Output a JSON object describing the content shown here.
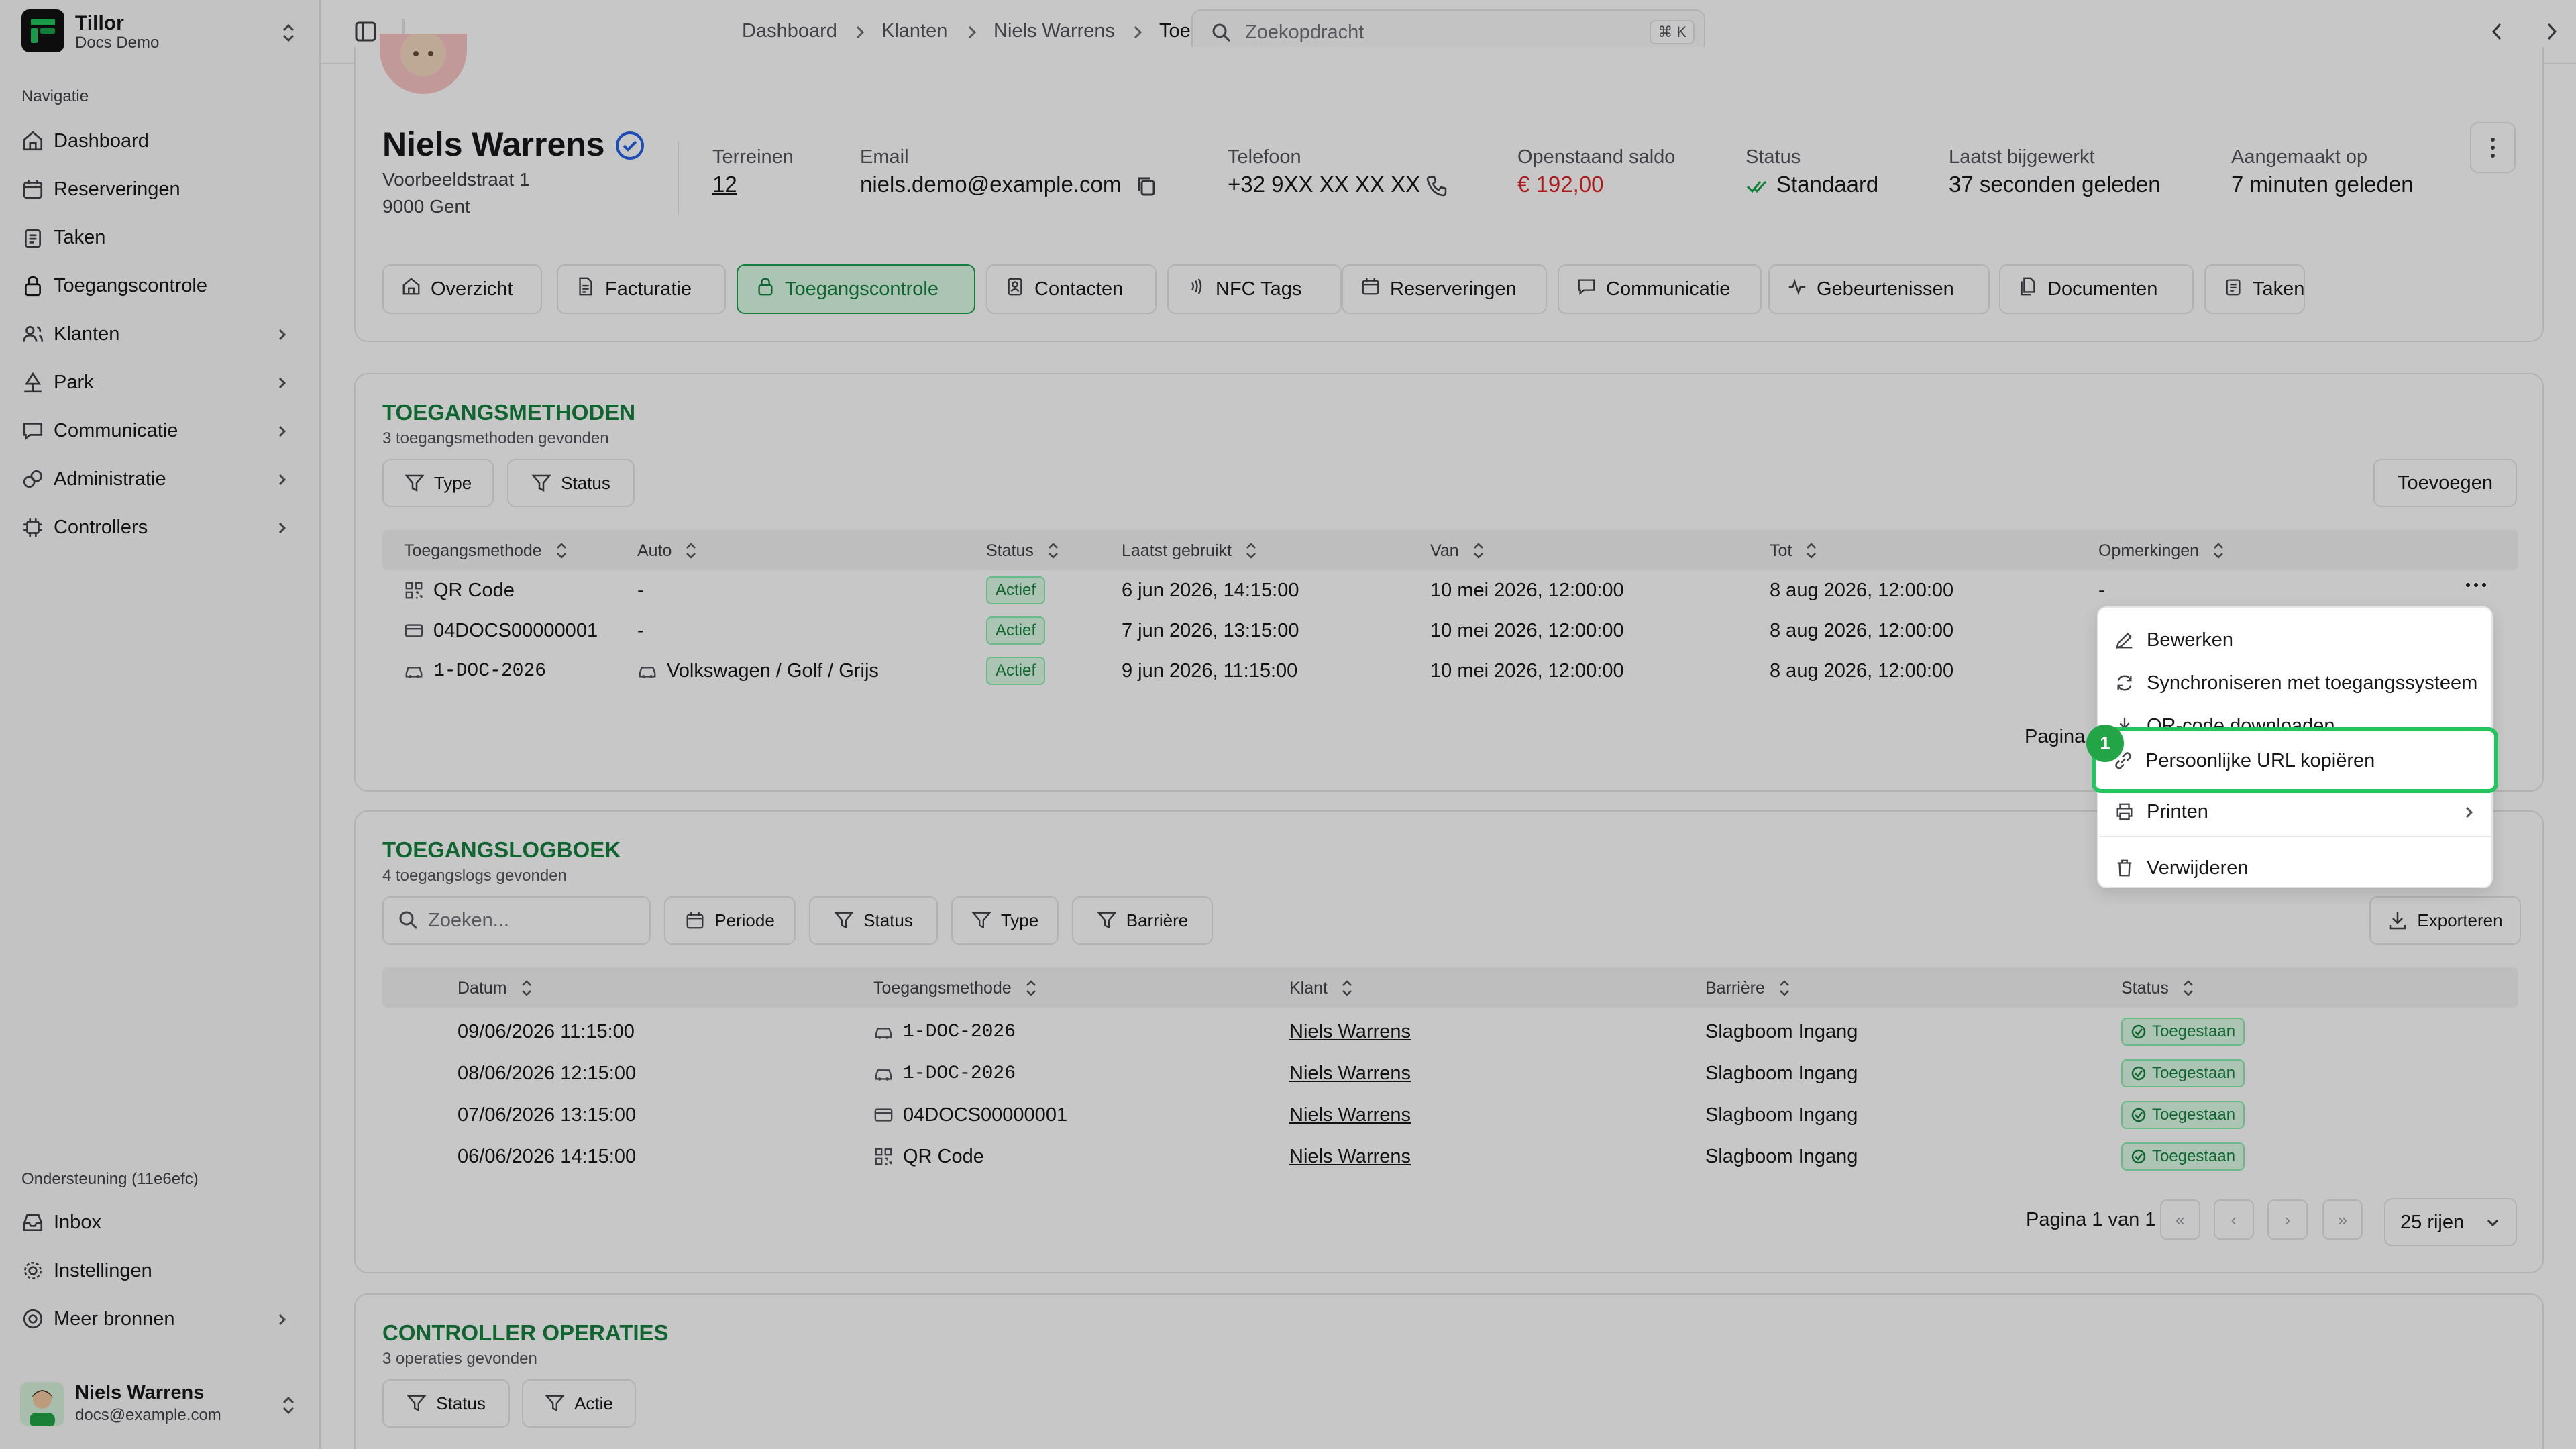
{
  "brand": {
    "name": "Tillor",
    "sub": "Docs Demo"
  },
  "nav": {
    "section_label": "Navigatie",
    "items": [
      {
        "label": "Dashboard",
        "icon": "home-icon"
      },
      {
        "label": "Reserveringen",
        "icon": "calendar-icon"
      },
      {
        "label": "Taken",
        "icon": "clipboard-icon"
      },
      {
        "label": "Toegangscontrole",
        "icon": "lock-icon"
      },
      {
        "label": "Klanten",
        "icon": "users-icon"
      },
      {
        "label": "Park",
        "icon": "tree-icon"
      },
      {
        "label": "Communicatie",
        "icon": "chat-icon"
      },
      {
        "label": "Administratie",
        "icon": "coins-icon"
      },
      {
        "label": "Controllers",
        "icon": "chip-icon"
      }
    ],
    "support_label": "Ondersteuning (11e6efc)",
    "support_items": [
      {
        "label": "Inbox",
        "icon": "inbox-icon"
      },
      {
        "label": "Instellingen",
        "icon": "gear-icon"
      },
      {
        "label": "Meer bronnen",
        "icon": "lifebuoy-icon"
      }
    ]
  },
  "user": {
    "name": "Niels Warrens",
    "email": "docs@example.com"
  },
  "breadcrumb": [
    "Dashboard",
    "Klanten",
    "Niels Warrens",
    "Toegangscontrole"
  ],
  "search": {
    "placeholder": "Zoekopdracht",
    "shortcut": "⌘ K"
  },
  "customer": {
    "name": "Niels Warrens",
    "address1": "Voorbeeldstraat 1",
    "address2": "9000 Gent",
    "fields": {
      "terreinen_label": "Terreinen",
      "terreinen": "12",
      "email_label": "Email",
      "email": "niels.demo@example.com",
      "telefoon_label": "Telefoon",
      "telefoon": "+32 9XX XX XX XX",
      "saldo_label": "Openstaand saldo",
      "saldo": "€ 192,00",
      "status_label": "Status",
      "status": "Standaard",
      "bijgewerkt_label": "Laatst bijgewerkt",
      "bijgewerkt": "37 seconden geleden",
      "aangemaakt_label": "Aangemaakt op",
      "aangemaakt": "7 minuten geleden"
    }
  },
  "tabs": [
    {
      "label": "Overzicht",
      "icon": "home-icon"
    },
    {
      "label": "Facturatie",
      "icon": "file-icon"
    },
    {
      "label": "Toegangscontrole",
      "icon": "lock-icon"
    },
    {
      "label": "Contacten",
      "icon": "contact-icon"
    },
    {
      "label": "NFC Tags",
      "icon": "nfc-icon"
    },
    {
      "label": "Reserveringen",
      "icon": "calendar-icon"
    },
    {
      "label": "Communicatie",
      "icon": "chat-icon"
    },
    {
      "label": "Gebeurtenissen",
      "icon": "activity-icon"
    },
    {
      "label": "Documenten",
      "icon": "documents-icon"
    },
    {
      "label": "Taken",
      "icon": "clipboard-icon"
    }
  ],
  "methods": {
    "title": "TOEGANGSMETHODEN",
    "subtitle": "3 toegangsmethoden gevonden",
    "filter_type": "Type",
    "filter_status": "Status",
    "add_button": "Toevoegen",
    "columns": [
      "Toegangsmethode",
      "Auto",
      "Status",
      "Laatst gebruikt",
      "Van",
      "Tot",
      "Opmerkingen"
    ],
    "rows": [
      {
        "method": "QR Code",
        "icon": "qr-icon",
        "auto": "-",
        "auto_icon": "",
        "status": "Actief",
        "last": "6 jun 2026, 14:15:00",
        "from": "10 mei 2026, 12:00:00",
        "to": "8 aug 2026, 12:00:00",
        "notes": "-"
      },
      {
        "method": "04DOCS00000001",
        "icon": "card-icon",
        "auto": "-",
        "auto_icon": "",
        "status": "Actief",
        "last": "7 jun 2026, 13:15:00",
        "from": "10 mei 2026, 12:00:00",
        "to": "8 aug 2026, 12:00:00",
        "notes": ""
      },
      {
        "method": "1-DOC-2026",
        "icon": "car-icon",
        "auto": "Volkswagen / Golf / Grijs",
        "auto_icon": "car-icon",
        "status": "Actief",
        "last": "9 jun 2026, 11:15:00",
        "from": "10 mei 2026, 12:00:00",
        "to": "8 aug 2026, 12:00:00",
        "notes": ""
      }
    ],
    "pagination": "Pagina"
  },
  "menu": {
    "items": [
      {
        "label": "Bewerken",
        "icon": "edit-icon"
      },
      {
        "label": "Synchroniseren met toegangssysteem",
        "icon": "sync-icon"
      },
      {
        "label": "QR-code downloaden",
        "icon": "download-icon"
      },
      {
        "label": "Persoonlijke URL kopiëren",
        "icon": "link-icon"
      },
      {
        "label": "Printen",
        "icon": "printer-icon"
      },
      {
        "label": "Verwijderen",
        "icon": "trash-icon"
      }
    ],
    "highlight_number": "1"
  },
  "logbook": {
    "title": "TOEGANGSLOGBOEK",
    "subtitle": "4 toegangslogs gevonden",
    "search_placeholder": "Zoeken...",
    "filters": [
      "Periode",
      "Status",
      "Type",
      "Barrière"
    ],
    "export_button": "Exporteren",
    "columns": [
      "Datum",
      "Toegangsmethode",
      "Klant",
      "Barrière",
      "Status"
    ],
    "rows": [
      {
        "date": "09/06/2026 11:15:00",
        "method": "1-DOC-2026",
        "icon": "car-icon",
        "customer": "Niels Warrens",
        "barrier": "Slagboom Ingang",
        "status": "Toegestaan"
      },
      {
        "date": "08/06/2026 12:15:00",
        "method": "1-DOC-2026",
        "icon": "car-icon",
        "customer": "Niels Warrens",
        "barrier": "Slagboom Ingang",
        "status": "Toegestaan"
      },
      {
        "date": "07/06/2026 13:15:00",
        "method": "04DOCS00000001",
        "icon": "card-icon",
        "customer": "Niels Warrens",
        "barrier": "Slagboom Ingang",
        "status": "Toegestaan"
      },
      {
        "date": "06/06/2026 14:15:00",
        "method": "QR Code",
        "icon": "qr-icon",
        "customer": "Niels Warrens",
        "barrier": "Slagboom Ingang",
        "status": "Toegestaan"
      }
    ],
    "pagination": "Pagina 1 van 1",
    "rows_select": "25 rijen"
  },
  "operations": {
    "title": "CONTROLLER OPERATIES",
    "subtitle": "3 operaties gevonden",
    "filters": [
      "Status",
      "Actie"
    ]
  },
  "colors": {
    "accent": "#15803d",
    "danger": "#dc2626",
    "highlight": "#22c55e"
  }
}
